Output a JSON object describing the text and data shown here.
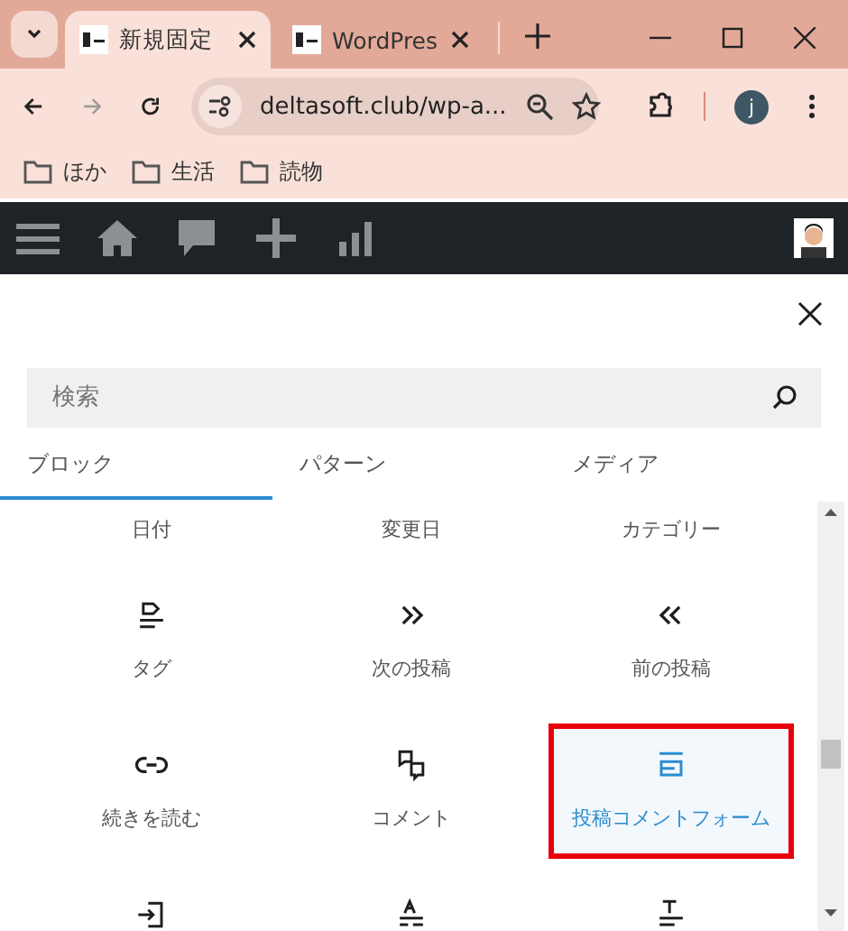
{
  "browser": {
    "tabs": [
      {
        "title": "新規固定",
        "selected": true
      },
      {
        "title": "WordPres",
        "selected": false
      }
    ],
    "address": "deltasoft.club/wp-a...",
    "profile": "j",
    "bookmarks": [
      "ほか",
      "生活",
      "読物"
    ]
  },
  "panel": {
    "search": {
      "placeholder": "検索"
    },
    "tabs": [
      {
        "label": "ブロック",
        "selected": true
      },
      {
        "label": "パターン",
        "selected": false
      },
      {
        "label": "メディア",
        "selected": false
      }
    ],
    "blocks": [
      {
        "label": "日付",
        "selected": false,
        "marked": false
      },
      {
        "label": "変更日",
        "selected": false,
        "marked": false
      },
      {
        "label": "カテゴリー",
        "selected": false,
        "marked": false
      },
      {
        "label": "タグ",
        "kind": "tag",
        "selected": false,
        "marked": false
      },
      {
        "label": "次の投稿",
        "kind": "next",
        "selected": false,
        "marked": false
      },
      {
        "label": "前の投稿",
        "kind": "previous",
        "selected": false,
        "marked": false
      },
      {
        "label": "続きを読む",
        "kind": "link",
        "selected": false,
        "marked": false
      },
      {
        "label": "コメント",
        "kind": "comments",
        "selected": false,
        "marked": false
      },
      {
        "label": "投稿コメントフォーム",
        "kind": "form",
        "selected": true,
        "marked": true
      },
      {
        "kind": "login",
        "selected": false,
        "marked": false
      },
      {
        "kind": "excerpt",
        "selected": false,
        "marked": false
      },
      {
        "kind": "title",
        "selected": false,
        "marked": false
      }
    ]
  }
}
